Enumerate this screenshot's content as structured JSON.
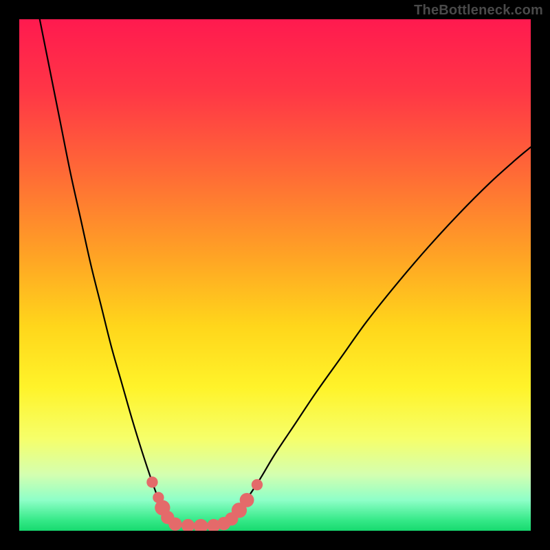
{
  "watermark": "TheBottleneck.com",
  "frame": {
    "outer_size": 800,
    "inner_left": 28,
    "inner_top": 28,
    "inner_width": 744,
    "inner_height": 744
  },
  "gradient_stops": [
    {
      "offset": 0.0,
      "color": "#ff1a4f"
    },
    {
      "offset": 0.14,
      "color": "#ff3646"
    },
    {
      "offset": 0.3,
      "color": "#ff6a36"
    },
    {
      "offset": 0.46,
      "color": "#ffa225"
    },
    {
      "offset": 0.6,
      "color": "#ffd61b"
    },
    {
      "offset": 0.72,
      "color": "#fff32a"
    },
    {
      "offset": 0.82,
      "color": "#f6ff6a"
    },
    {
      "offset": 0.89,
      "color": "#d4ffb0"
    },
    {
      "offset": 0.94,
      "color": "#8effc8"
    },
    {
      "offset": 0.98,
      "color": "#34e987"
    },
    {
      "offset": 1.0,
      "color": "#17d96f"
    }
  ],
  "chart_data": {
    "type": "line",
    "title": "",
    "xlabel": "",
    "ylabel": "",
    "xlim": [
      0,
      100
    ],
    "ylim": [
      0,
      100
    ],
    "series": [
      {
        "name": "left-branch",
        "x": [
          4,
          6,
          8,
          10,
          12,
          14,
          16,
          18,
          20,
          22,
          24,
          26,
          27.5,
          29,
          30
        ],
        "y": [
          100,
          90,
          80,
          70,
          61,
          52,
          44,
          36,
          29,
          22,
          15.5,
          9.5,
          5.5,
          2.5,
          1.3
        ]
      },
      {
        "name": "valley-floor",
        "x": [
          30,
          32,
          34,
          36,
          38,
          40
        ],
        "y": [
          1.3,
          1.0,
          0.9,
          0.9,
          1.0,
          1.3
        ]
      },
      {
        "name": "right-branch",
        "x": [
          40,
          42,
          44,
          47,
          50,
          54,
          58,
          63,
          68,
          74,
          80,
          86,
          92,
          97,
          100
        ],
        "y": [
          1.3,
          2.8,
          5.5,
          10,
          15,
          21,
          27,
          34,
          41,
          48.5,
          55.5,
          62,
          68,
          72.5,
          75
        ]
      }
    ],
    "markers": [
      {
        "name": "left-marker-upper",
        "x": 26.0,
        "y": 9.5,
        "r": 1.1
      },
      {
        "name": "left-marker-mid1",
        "x": 27.2,
        "y": 6.5,
        "r": 1.1
      },
      {
        "name": "left-marker-mid2",
        "x": 28.0,
        "y": 4.5,
        "r": 1.5
      },
      {
        "name": "left-marker-lower",
        "x": 29.0,
        "y": 2.6,
        "r": 1.3
      },
      {
        "name": "floor-marker-1",
        "x": 30.5,
        "y": 1.3,
        "r": 1.3
      },
      {
        "name": "floor-marker-2",
        "x": 33.0,
        "y": 1.0,
        "r": 1.3
      },
      {
        "name": "floor-marker-3",
        "x": 35.5,
        "y": 0.9,
        "r": 1.4
      },
      {
        "name": "floor-marker-4",
        "x": 38.0,
        "y": 1.0,
        "r": 1.3
      },
      {
        "name": "floor-marker-5",
        "x": 40.0,
        "y": 1.4,
        "r": 1.3
      },
      {
        "name": "right-marker-lower",
        "x": 41.5,
        "y": 2.3,
        "r": 1.3
      },
      {
        "name": "right-marker-mid1",
        "x": 43.0,
        "y": 4.0,
        "r": 1.5
      },
      {
        "name": "right-marker-mid2",
        "x": 44.5,
        "y": 6.0,
        "r": 1.4
      },
      {
        "name": "right-marker-upper",
        "x": 46.5,
        "y": 9.0,
        "r": 1.1
      }
    ],
    "marker_color": "#e46a6a",
    "curve_color": "#000000",
    "curve_width": 2.2
  }
}
